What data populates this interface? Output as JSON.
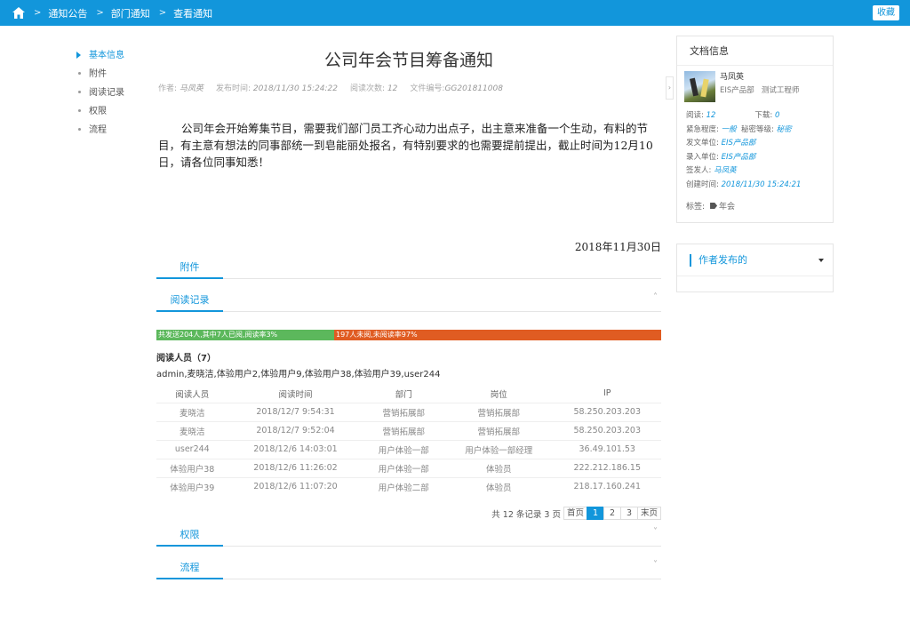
{
  "topbar": {
    "breadcrumbs": [
      "通知公告",
      "部门通知",
      "查看通知"
    ],
    "collect_label": "收藏",
    "accent": "#1296db"
  },
  "leftnav": {
    "items": [
      "基本信息",
      "附件",
      "阅读记录",
      "权限",
      "流程"
    ],
    "active_index": 0
  },
  "article": {
    "title": "公司年会节目筹备通知",
    "meta": {
      "author_label": "作者:",
      "author": "马凤英",
      "time_label": "发布时间:",
      "time": "2018/11/30 15:24:22",
      "reads_label": "阅读次数:",
      "reads": "12",
      "doc_label": "文件编号:",
      "doc_no": "GG201811008"
    },
    "body": "公司年会开始筹集节目，需要我们部门员工齐心动力出点子，出主意来准备一个生动，有料的节目，有主意有想法的同事部统一到皂能丽处报名，有特别要求的也需要提前提出，截止时间为12月10日，请各位同事知悉！",
    "date": "2018年11月30日"
  },
  "sections": {
    "attachment": "附件",
    "read_records": "阅读记录",
    "permissions": "权限",
    "process": "流程"
  },
  "progress": {
    "read_text": "共发送204人,其中7人已阅,阅读率3%",
    "unread_text": "197人未阅,未阅读率97%",
    "read_ratio": 0.03,
    "read_color": "#5cb85c",
    "unread_color": "#e05c22"
  },
  "readers": {
    "heading": "阅读人员（7）",
    "list": "admin,麦晓洁,体验用户2,体验用户9,体验用户38,体验用户39,user244"
  },
  "table": {
    "headers": [
      "阅读人员",
      "阅读时间",
      "部门",
      "岗位",
      "IP"
    ],
    "rows": [
      [
        "麦晓洁",
        "2018/12/7 9:54:31",
        "营销拓展部",
        "营销拓展部",
        "58.250.203.203"
      ],
      [
        "麦晓洁",
        "2018/12/7 9:52:04",
        "营销拓展部",
        "营销拓展部",
        "58.250.203.203"
      ],
      [
        "user244",
        "2018/12/6 14:03:01",
        "用户体验一部",
        "用户体验一部经理",
        "36.49.101.53"
      ],
      [
        "体验用户38",
        "2018/12/6 11:26:02",
        "用户体验一部",
        "体验员",
        "222.212.186.15"
      ],
      [
        "体验用户39",
        "2018/12/6 11:07:20",
        "用户体验二部",
        "体验员",
        "218.17.160.241"
      ]
    ]
  },
  "pager": {
    "info": "共 12 条记录 3 页",
    "first": "首页",
    "pages": [
      "1",
      "2",
      "3"
    ],
    "current": "1",
    "last": "末页"
  },
  "docinfo": {
    "heading": "文档信息",
    "user_name": "马凤英",
    "user_dept": "EIS产品部",
    "user_title": "测试工程师",
    "reads_label": "阅读:",
    "reads": "12",
    "downloads_label": "下载:",
    "downloads": "0",
    "urgency_label": "紧急程度:",
    "urgency": "一般",
    "secrecy_label": "秘密等级:",
    "secrecy": "秘密",
    "issuer_label": "发文单位:",
    "issuer": "EIS产品部",
    "entry_label": "录入单位:",
    "entry": "EIS产品部",
    "signer_label": "签发人:",
    "signer": "马凤英",
    "created_label": "创建时间:",
    "created": "2018/11/30 15:24:21",
    "tags_label": "标签:",
    "tag": "年会"
  },
  "author_posts": {
    "heading": "作者发布的"
  }
}
